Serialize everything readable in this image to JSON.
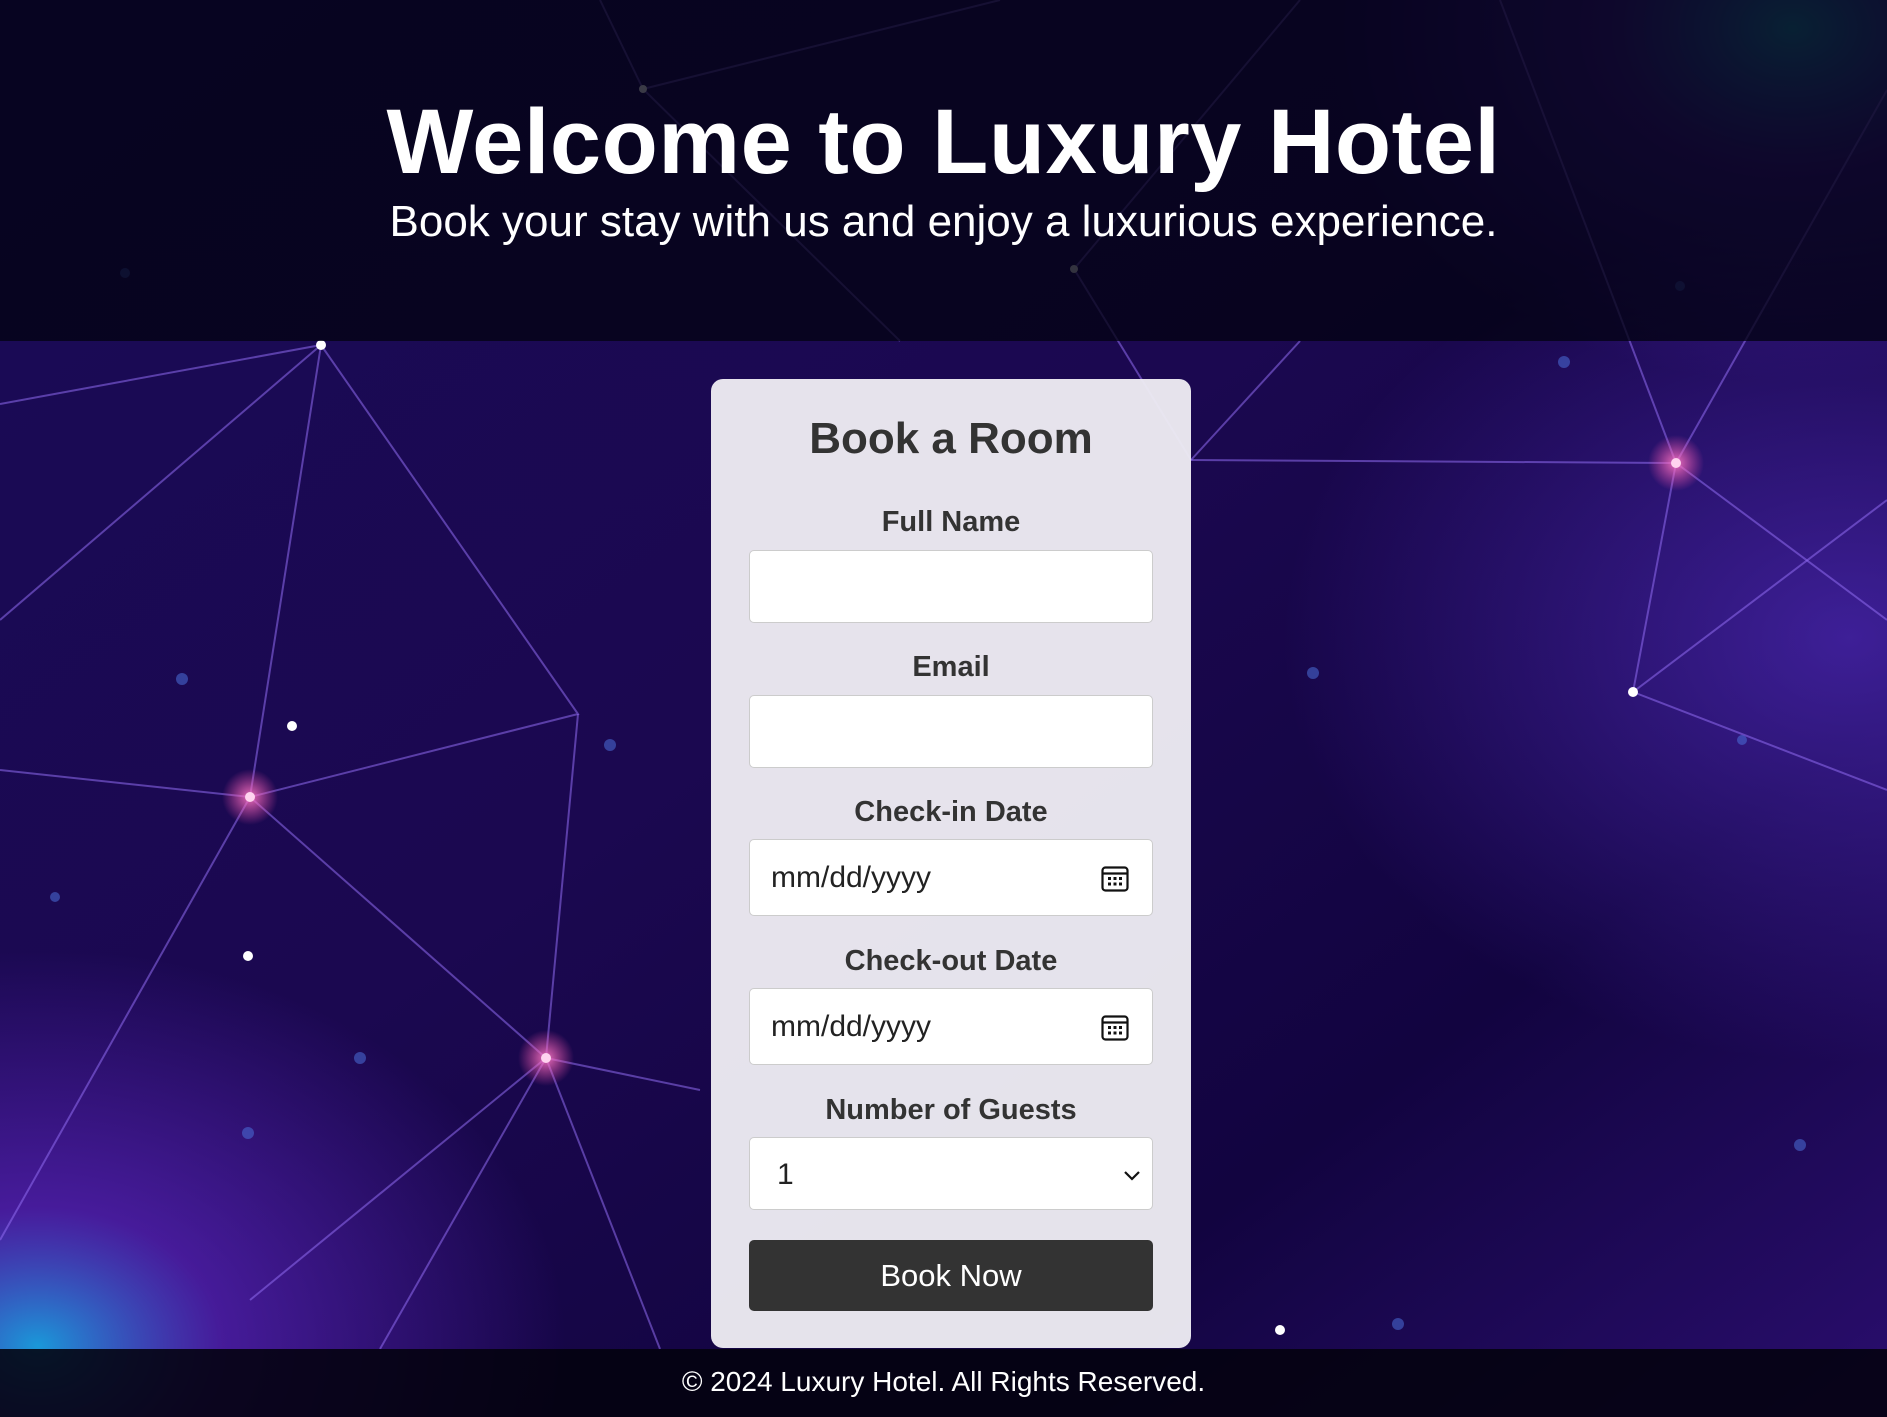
{
  "header": {
    "title": "Welcome to Luxury Hotel",
    "subtitle": "Book your stay with us and enjoy a luxurious experience."
  },
  "form": {
    "title": "Book a Room",
    "full_name": {
      "label": "Full Name",
      "value": ""
    },
    "email": {
      "label": "Email",
      "value": ""
    },
    "check_in": {
      "label": "Check-in Date",
      "value": "mm/dd/yyyy",
      "icon": "calendar-icon"
    },
    "check_out": {
      "label": "Check-out Date",
      "value": "mm/dd/yyyy",
      "icon": "calendar-icon"
    },
    "guests": {
      "label": "Number of Guests",
      "selected": "1",
      "icon": "chevron-down-icon"
    },
    "submit_label": "Book Now"
  },
  "footer": {
    "text": "© 2024 Luxury Hotel. All Rights Reserved."
  },
  "colors": {
    "background": "#16063f",
    "card": "#eeecf3",
    "button": "#333333",
    "text_dark": "#333333"
  }
}
